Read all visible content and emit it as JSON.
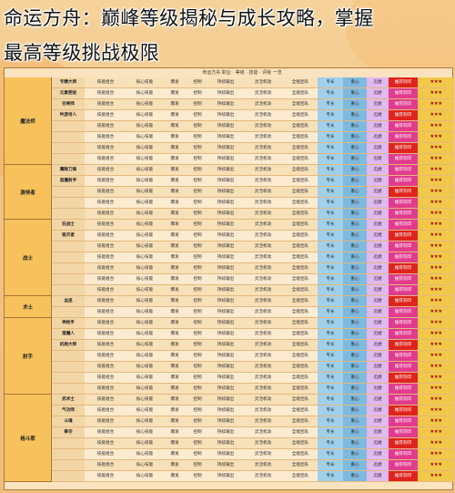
{
  "headline": {
    "line1": "命运方舟：巅峰等级揭秘与成长攻略，掌握",
    "line2": "最高等级挑战极限"
  },
  "sheet_title": "命运方舟 职业 · 等级 · 技能 · 评级 一览",
  "colors": {
    "group_label": "#f7c25c",
    "pink_cell": "#e23b8e",
    "red_cell": "#e0241d",
    "star_cell": "#f2c84a",
    "blue_cell": "#9fd0ec",
    "purple_cell": "#e2b9f0"
  },
  "groups": [
    {
      "label": "魔法师",
      "subclasses": [
        "专精大师",
        "元素使徒",
        "召唤师",
        "吟游诗人",
        "",
        "",
        "",
        ""
      ]
    },
    {
      "label": "游侠者",
      "subclasses": [
        "鹰眼刀锋",
        "恶魔射手",
        "",
        "",
        ""
      ]
    },
    {
      "label": "战士",
      "subclasses": [
        "狂战士",
        "毁灭者",
        "",
        "",
        "",
        "",
        ""
      ]
    },
    {
      "label": "术士",
      "subclasses": [
        "血巫",
        ""
      ]
    },
    {
      "label": "射手",
      "subclasses": [
        "神枪手",
        "猎魔人",
        "机炮大师",
        "",
        "",
        "",
        ""
      ]
    },
    {
      "label": "格斗家",
      "subclasses": [
        "武术士",
        "气功师",
        "斗魂",
        "拳宗",
        "",
        "",
        "",
        ""
      ]
    }
  ],
  "row_cells": {
    "skill1": "技能组合",
    "skill2": "核心技能",
    "s3": "爆发",
    "s4": "控制",
    "s5": "持续输出",
    "s6": "灵活机动",
    "s7": "全能团队",
    "s8": "专长",
    "s9": "重心",
    "s10": "迅捷",
    "s11": "推荐刻印",
    "stars": "★★★"
  }
}
